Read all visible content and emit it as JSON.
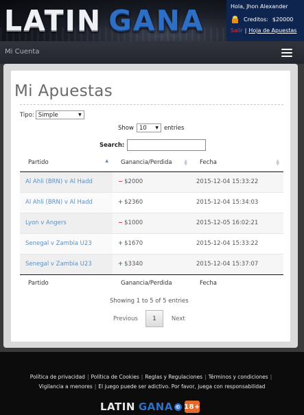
{
  "header": {
    "logo_part1": "LATIN",
    "logo_part2": "GANA",
    "greeting": "Hola, Jhon Alexander",
    "credits_label": "Creditos:",
    "credits_value": "$20000",
    "logout_label": "Salir",
    "link_separator": "|",
    "bets_sheet_label": "Hoja de Apuestas",
    "credits_icon": "coin-stack-icon"
  },
  "nav": {
    "title": "Mi Cuenta",
    "menu_icon": "hamburger-menu-icon"
  },
  "page": {
    "title": "Mi Apuestas"
  },
  "filters": {
    "tipo_label": "Tipo:",
    "tipo_value": "Simple",
    "show_label": "Show",
    "show_value": "10",
    "entries_label": "entries",
    "search_label": "Search:",
    "search_value": ""
  },
  "table": {
    "headers": [
      "Partido",
      "Ganancia/Perdida",
      "Fecha"
    ],
    "footers": [
      "Partido",
      "Ganancia/Perdida",
      "Fecha"
    ],
    "rows": [
      {
        "partido": "Al Ahli (BRN) v Al Hadd",
        "sign": "−",
        "amount": "$2000",
        "fecha": "2015-12-04 15:33:22",
        "positive": false
      },
      {
        "partido": "Al Ahli (BRN) v Al Hadd",
        "sign": "+",
        "amount": "$2360",
        "fecha": "2015-12-04 15:34:03",
        "positive": true
      },
      {
        "partido": "Lyon v Angers",
        "sign": "−",
        "amount": "$1000",
        "fecha": "2015-12-05 16:02:21",
        "positive": false
      },
      {
        "partido": "Senegal v Zambia U23",
        "sign": "+",
        "amount": "$1670",
        "fecha": "2015-12-04 15:33:22",
        "positive": true
      },
      {
        "partido": "Senegal v Zambia U23",
        "sign": "+",
        "amount": "$3340",
        "fecha": "2015-12-04 15:37:07",
        "positive": true
      }
    ]
  },
  "pagination": {
    "info": "Showing 1 to 5 of 5 entries",
    "previous": "Previous",
    "current_page": "1",
    "next": "Next"
  },
  "footer": {
    "links_row1": [
      "Política de privacidad",
      "Política de Cookies",
      "Reglas y Regulaciones",
      "Términos y condiciones"
    ],
    "links_row2": [
      "Vigilancia a menores",
      "El juego puede ser adictivo. Por favor, juega con responsabilidad"
    ],
    "separator": "|",
    "logo_part1": "LATIN",
    "logo_part2": "GANA",
    "logo_mark": "©",
    "age_badge": "18+"
  },
  "colors": {
    "accent_blue": "#2e6fc6",
    "user_box": "#0e2550",
    "loss": "#d23c3c",
    "gain": "#3c9a3c",
    "link": "#5e8fbf"
  }
}
